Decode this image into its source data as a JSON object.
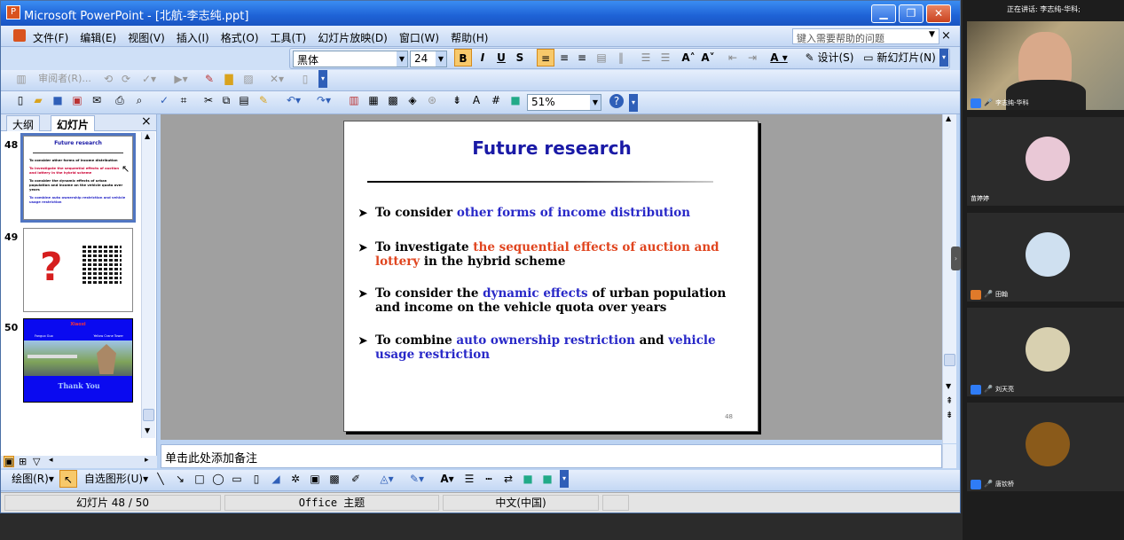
{
  "window": {
    "title": "Microsoft PowerPoint - [北航-李志纯.ppt]",
    "minimize": "▁",
    "restore": "❐",
    "close": "✕"
  },
  "menu": {
    "items": [
      "文件(F)",
      "编辑(E)",
      "视图(V)",
      "插入(I)",
      "格式(O)",
      "工具(T)",
      "幻灯片放映(D)",
      "窗口(W)",
      "帮助(H)"
    ],
    "help_placeholder": "键入需要帮助的问题",
    "close_glyph": "×"
  },
  "format_toolbar": {
    "font": "黑体",
    "size": "24",
    "bold": "B",
    "italic": "I",
    "underline": "U",
    "shadow": "S",
    "design_label": "设计(S)",
    "new_slide_label": "新幻灯片(N)"
  },
  "review_toolbar": {
    "reviewer_label": "审阅者(R)..."
  },
  "standard_toolbar": {
    "zoom": "51%"
  },
  "outline_tabs": {
    "outline": "大纲",
    "slides": "幻灯片",
    "close": "×"
  },
  "thumbnails": [
    {
      "num": "48",
      "title": "Future research",
      "lines": [
        "To consider other forms of income distribution",
        "To investigate the sequential effects of auction and lottery in the hybrid scheme",
        "To consider the dynamic effects of urban population and income on the vehicle quota over years",
        "To combine auto ownership restriction and vehicle usage restriction"
      ]
    },
    {
      "num": "49"
    },
    {
      "num": "50",
      "title": "Thank You",
      "head": "Xiaoxi",
      "caption_left": "Fanguo Guo",
      "caption_right": "Yellow Crane Tower",
      "footer": "Thank You"
    }
  ],
  "slide": {
    "title": "Future research",
    "page_number": "48",
    "bullets": [
      {
        "parts": [
          {
            "t": "To consider ",
            "c": "plain"
          },
          {
            "t": "other forms of income distribution",
            "c": "blue"
          }
        ]
      },
      {
        "parts": [
          {
            "t": "To investigate ",
            "c": "plain"
          },
          {
            "t": "the sequential effects of auction and lottery",
            "c": "red"
          },
          {
            "t": " in the hybrid scheme",
            "c": "plain"
          }
        ]
      },
      {
        "parts": [
          {
            "t": "To consider the ",
            "c": "plain"
          },
          {
            "t": "dynamic effects",
            "c": "blue"
          },
          {
            "t": " of urban population and income on the vehicle quota over years",
            "c": "plain"
          }
        ]
      },
      {
        "parts": [
          {
            "t": "To combine ",
            "c": "plain"
          },
          {
            "t": "auto ownership restriction",
            "c": "blue"
          },
          {
            "t": " and ",
            "c": "plain"
          },
          {
            "t": "vehicle usage restriction",
            "c": "blue"
          }
        ]
      }
    ]
  },
  "notes": {
    "placeholder": "单击此处添加备注"
  },
  "draw_toolbar": {
    "draw_label": "绘图(R)",
    "autoshape_label": "自选图形(U)"
  },
  "status": {
    "slide_pos": "幻灯片 48 / 50",
    "theme": "Office 主题",
    "language": "中文(中国)"
  },
  "meeting": {
    "speaking": "正在讲话: 李志纯-华科;",
    "participants": [
      {
        "name": "李志纯-华科",
        "type": "camera"
      },
      {
        "name": "苗婷婷",
        "type": "avatar",
        "avatar_color": "#e9c8d6"
      },
      {
        "name": "田翰",
        "type": "avatar",
        "avatar_color": "#cfe0f0"
      },
      {
        "name": "刘天亮",
        "type": "avatar",
        "avatar_color": "#d8d0b0"
      },
      {
        "name": "唐钦桥",
        "type": "avatar",
        "avatar_color": "#8a5a1a"
      }
    ]
  },
  "colors": {
    "title_blue": "#1a1aa6",
    "highlight_blue": "#2828c8",
    "highlight_red": "#e0451f",
    "ppt_blue": "#1e62d6"
  }
}
